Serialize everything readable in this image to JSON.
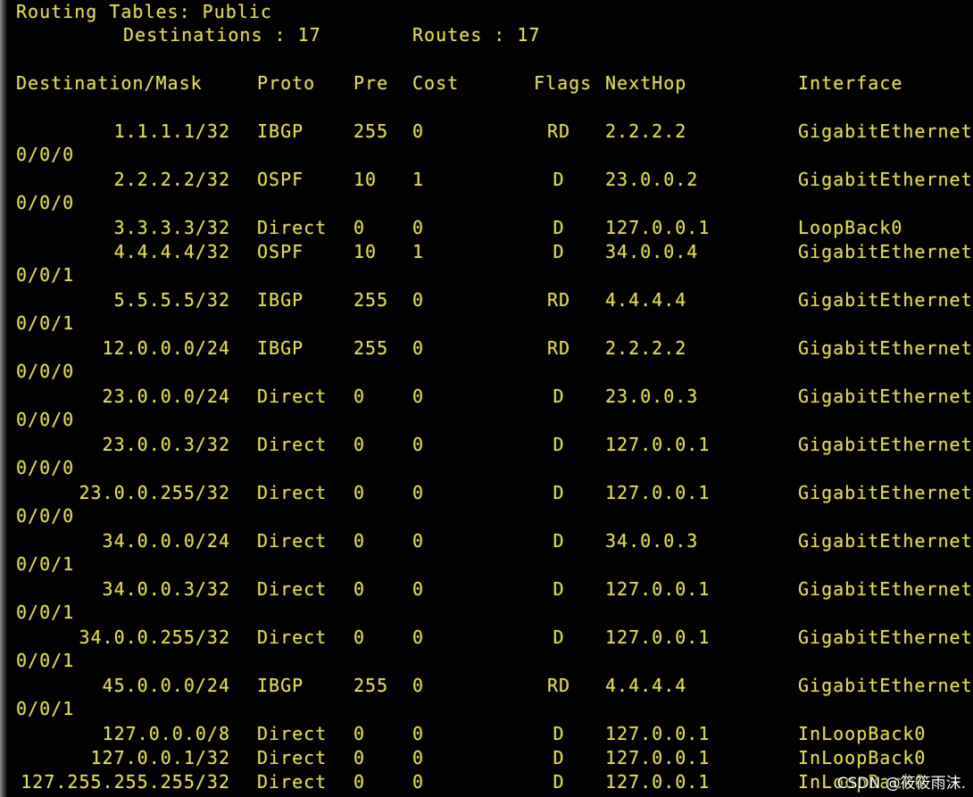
{
  "header": {
    "title": "Routing Tables: Public",
    "destinations_label": "Destinations : 17",
    "routes_label": "Routes : 17"
  },
  "columns": [
    "Destination/Mask",
    "Proto",
    "Pre",
    "Cost",
    "Flags",
    "NextHop",
    "Interface"
  ],
  "routes": [
    {
      "dest": "1.1.1.1/32",
      "proto": "IBGP",
      "pre": "255",
      "cost": "0",
      "flags": "RD",
      "nexthop": "2.2.2.2",
      "iface": "GigabitEthernet",
      "iface_cont": "0/0/0"
    },
    {
      "dest": "2.2.2.2/32",
      "proto": "OSPF",
      "pre": "10",
      "cost": "1",
      "flags": "D",
      "nexthop": "23.0.0.2",
      "iface": "GigabitEthernet",
      "iface_cont": "0/0/0"
    },
    {
      "dest": "3.3.3.3/32",
      "proto": "Direct",
      "pre": "0",
      "cost": "0",
      "flags": "D",
      "nexthop": "127.0.0.1",
      "iface": "LoopBack0",
      "iface_cont": ""
    },
    {
      "dest": "4.4.4.4/32",
      "proto": "OSPF",
      "pre": "10",
      "cost": "1",
      "flags": "D",
      "nexthop": "34.0.0.4",
      "iface": "GigabitEthernet",
      "iface_cont": "0/0/1"
    },
    {
      "dest": "5.5.5.5/32",
      "proto": "IBGP",
      "pre": "255",
      "cost": "0",
      "flags": "RD",
      "nexthop": "4.4.4.4",
      "iface": "GigabitEthernet",
      "iface_cont": "0/0/1"
    },
    {
      "dest": "12.0.0.0/24",
      "proto": "IBGP",
      "pre": "255",
      "cost": "0",
      "flags": "RD",
      "nexthop": "2.2.2.2",
      "iface": "GigabitEthernet",
      "iface_cont": "0/0/0"
    },
    {
      "dest": "23.0.0.0/24",
      "proto": "Direct",
      "pre": "0",
      "cost": "0",
      "flags": "D",
      "nexthop": "23.0.0.3",
      "iface": "GigabitEthernet",
      "iface_cont": "0/0/0"
    },
    {
      "dest": "23.0.0.3/32",
      "proto": "Direct",
      "pre": "0",
      "cost": "0",
      "flags": "D",
      "nexthop": "127.0.0.1",
      "iface": "GigabitEthernet",
      "iface_cont": "0/0/0"
    },
    {
      "dest": "23.0.0.255/32",
      "proto": "Direct",
      "pre": "0",
      "cost": "0",
      "flags": "D",
      "nexthop": "127.0.0.1",
      "iface": "GigabitEthernet",
      "iface_cont": "0/0/0"
    },
    {
      "dest": "34.0.0.0/24",
      "proto": "Direct",
      "pre": "0",
      "cost": "0",
      "flags": "D",
      "nexthop": "34.0.0.3",
      "iface": "GigabitEthernet",
      "iface_cont": "0/0/1"
    },
    {
      "dest": "34.0.0.3/32",
      "proto": "Direct",
      "pre": "0",
      "cost": "0",
      "flags": "D",
      "nexthop": "127.0.0.1",
      "iface": "GigabitEthernet",
      "iface_cont": "0/0/1"
    },
    {
      "dest": "34.0.0.255/32",
      "proto": "Direct",
      "pre": "0",
      "cost": "0",
      "flags": "D",
      "nexthop": "127.0.0.1",
      "iface": "GigabitEthernet",
      "iface_cont": "0/0/1"
    },
    {
      "dest": "45.0.0.0/24",
      "proto": "IBGP",
      "pre": "255",
      "cost": "0",
      "flags": "RD",
      "nexthop": "4.4.4.4",
      "iface": "GigabitEthernet",
      "iface_cont": "0/0/1"
    },
    {
      "dest": "127.0.0.0/8",
      "proto": "Direct",
      "pre": "0",
      "cost": "0",
      "flags": "D",
      "nexthop": "127.0.0.1",
      "iface": "InLoopBack0",
      "iface_cont": ""
    },
    {
      "dest": "127.0.0.1/32",
      "proto": "Direct",
      "pre": "0",
      "cost": "0",
      "flags": "D",
      "nexthop": "127.0.0.1",
      "iface": "InLoopBack0",
      "iface_cont": ""
    },
    {
      "dest": "127.255.255.255/32",
      "proto": "Direct",
      "pre": "0",
      "cost": "0",
      "flags": "D",
      "nexthop": "127.0.0.1",
      "iface": "InLoopBack0",
      "iface_cont": ""
    }
  ],
  "watermark": "CSDN @筱筱雨沫.",
  "colors": {
    "background": "#020202",
    "text": "#dcd858",
    "watermark": "#ffffff"
  }
}
